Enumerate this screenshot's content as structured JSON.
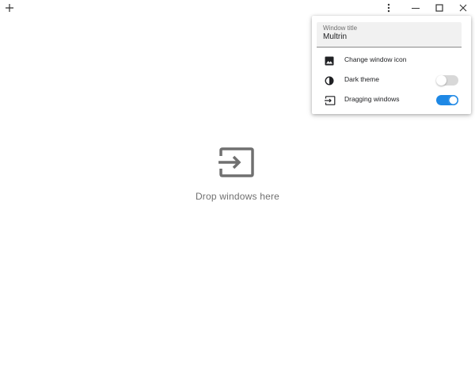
{
  "titlebar": {
    "add_tab_icon": "plus-icon",
    "menu_icon": "more-vert-icon",
    "minimize_icon": "minimize-icon",
    "maximize_icon": "maximize-icon",
    "close_icon": "close-icon"
  },
  "drop_area": {
    "icon": "input-arrow-icon",
    "text": "Drop windows here",
    "text_color": "#707070",
    "icon_color": "#707070"
  },
  "settings_popup": {
    "window_title": {
      "label": "Window title",
      "value": "Multrin"
    },
    "items": [
      {
        "label": "Change window icon",
        "icon": "image-icon"
      },
      {
        "label": "Dark theme",
        "icon": "contrast-icon",
        "toggle": false
      },
      {
        "label": "Dragging windows",
        "icon": "input-arrow-icon",
        "toggle": true
      }
    ],
    "toggle_on_color": "#1e88e5",
    "toggle_off_color": "#d8d8d8"
  }
}
